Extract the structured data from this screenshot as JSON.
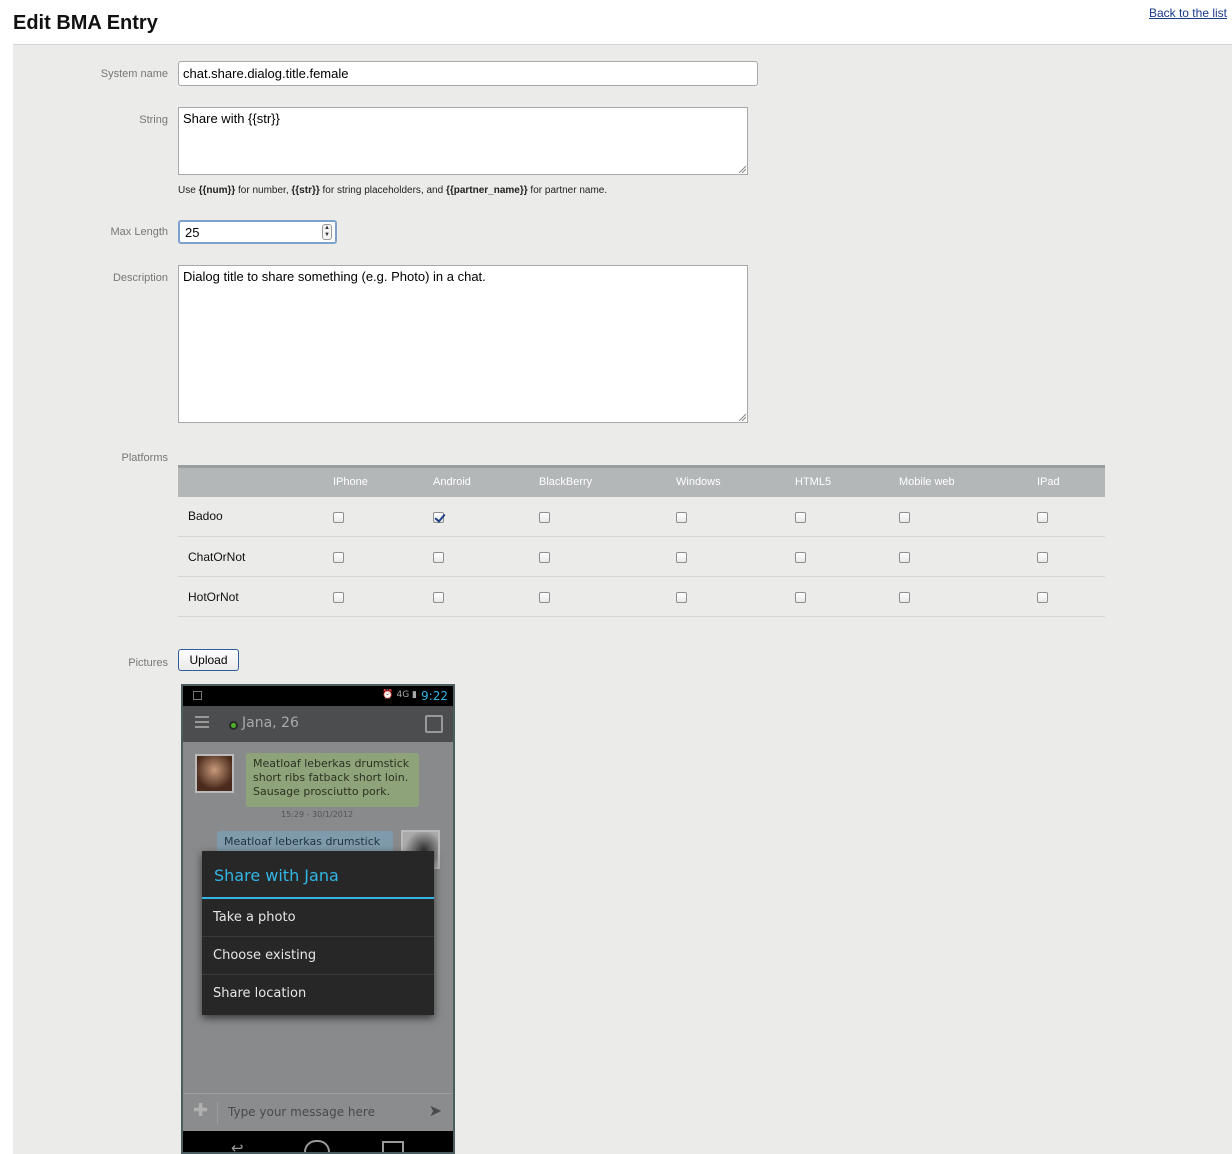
{
  "header": {
    "title": "Edit BMA Entry",
    "back_link": "Back to the list"
  },
  "form": {
    "system_name": {
      "label": "System name",
      "value": "chat.share.dialog.title.female"
    },
    "string": {
      "label": "String",
      "value": "Share with {{str}}"
    },
    "hint": {
      "prefix": "Use ",
      "num": "{{num}}",
      "mid1": " for number, ",
      "str": "{{str}}",
      "mid2": " for string placeholders, and ",
      "partner": "{{partner_name}}",
      "suffix": " for partner name."
    },
    "max_length": {
      "label": "Max Length",
      "value": "25"
    },
    "description": {
      "label": "Description",
      "value": "Dialog title to share something (e.g. Photo) in a chat."
    },
    "platforms_label": "Platforms",
    "pictures_label": "Pictures",
    "upload_label": "Upload"
  },
  "platforms": {
    "columns": [
      "IPhone",
      "Android",
      "BlackBerry",
      "Windows",
      "HTML5",
      "Mobile web",
      "IPad"
    ],
    "rows": [
      {
        "name": "Badoo",
        "checked": [
          false,
          true,
          false,
          false,
          false,
          false,
          false
        ]
      },
      {
        "name": "ChatOrNot",
        "checked": [
          false,
          false,
          false,
          false,
          false,
          false,
          false
        ]
      },
      {
        "name": "HotOrNot",
        "checked": [
          false,
          false,
          false,
          false,
          false,
          false,
          false
        ]
      }
    ]
  },
  "phone": {
    "time": "9:22",
    "status_icons": "⏰ 4G ▮",
    "contact": "Jana, 26",
    "incoming_message": "Meatloaf leberkas drumstick short ribs fatback short loin. Sausage prosciutto pork.",
    "message_time": "15:29 - 30/1/2012",
    "outgoing_message": "Meatloaf leberkas drumstick",
    "dialog_title": "Share with Jana",
    "dialog_items": [
      "Take a photo",
      "Choose existing",
      "Share location"
    ],
    "compose_placeholder": "Type your message here",
    "accent_color": "#33b5e5"
  }
}
